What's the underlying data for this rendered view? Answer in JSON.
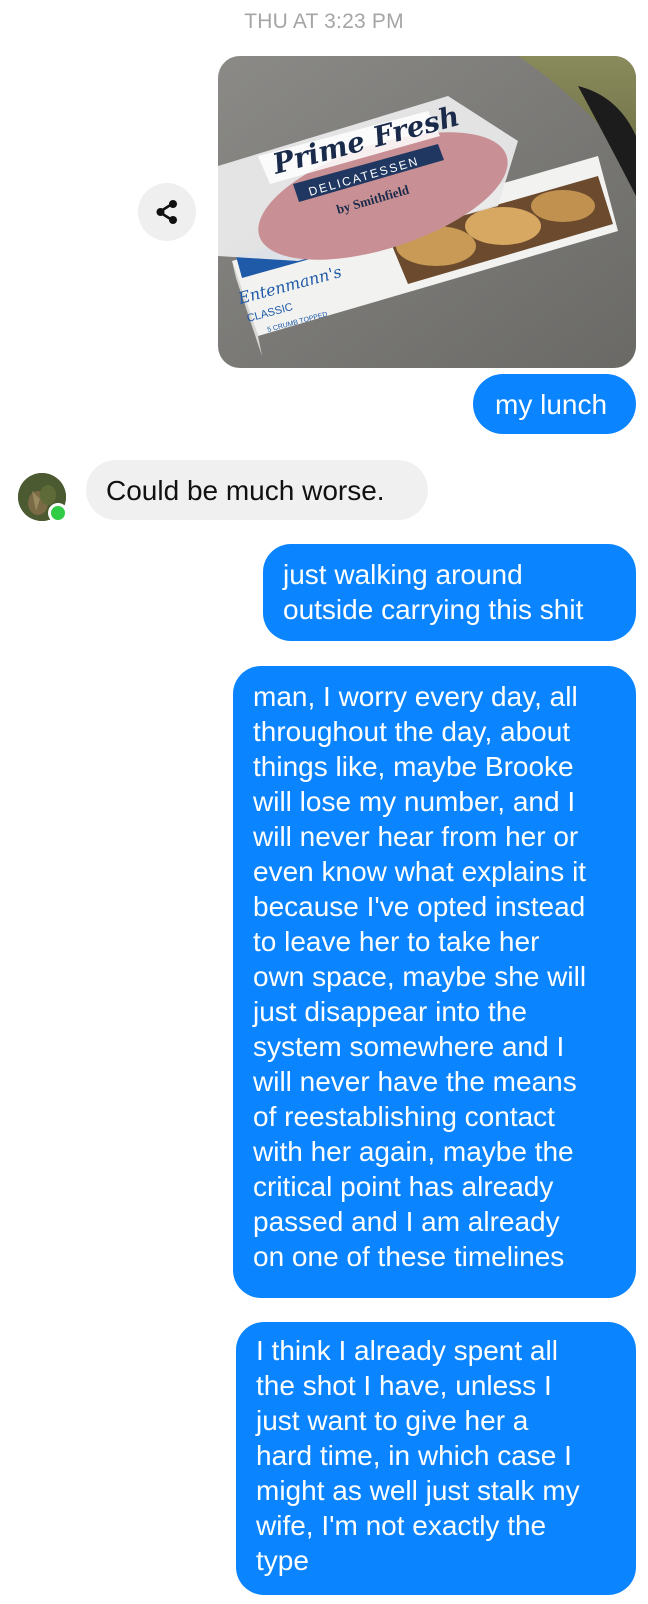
{
  "header": {
    "timestamp": "THU AT 3:23 PM"
  },
  "share": {
    "icon": "share-icon"
  },
  "photo": {
    "alt": "my lunch photo",
    "brand_top": "Prime Fresh",
    "brand_sub": "DELICATESSEN",
    "brand_by": "by Smithfield",
    "box_brand": "Entenmann's",
    "box_label": "CLASSIC",
    "box_sub": "5 CRUMB TOPPED"
  },
  "contact": {
    "avatar_icon": "contact-avatar",
    "online_color": "#31cc46"
  },
  "messages": [
    {
      "direction": "out",
      "lines": [
        "my lunch"
      ]
    },
    {
      "direction": "in",
      "lines": [
        "Could be much worse."
      ]
    },
    {
      "direction": "out",
      "lines": [
        "just walking around",
        "outside carrying this shit"
      ]
    },
    {
      "direction": "out",
      "lines": [
        "man, I worry every day, all",
        "throughout the day, about",
        "things like, maybe Brooke",
        "will lose my number, and I",
        "will never hear from her or",
        "even know what explains it",
        "because I've opted instead",
        "to leave her to take her",
        "own space, maybe she will",
        "just disappear into the",
        "system somewhere and I",
        "will never have the means",
        "of reestablishing contact",
        "with her again, maybe the",
        "critical point has already",
        "passed and I am already",
        "on one of these timelines"
      ]
    },
    {
      "direction": "out",
      "lines": [
        "I think I already spent all",
        "the shot I have, unless I",
        "just want to give her a",
        "hard time, in which case I",
        "might as well just stalk my",
        "wife, I'm not exactly the",
        "type"
      ]
    }
  ],
  "colors": {
    "outgoing": "#0a84ff",
    "incoming": "#f0f0f0",
    "timestamp": "#a5a5a5"
  }
}
